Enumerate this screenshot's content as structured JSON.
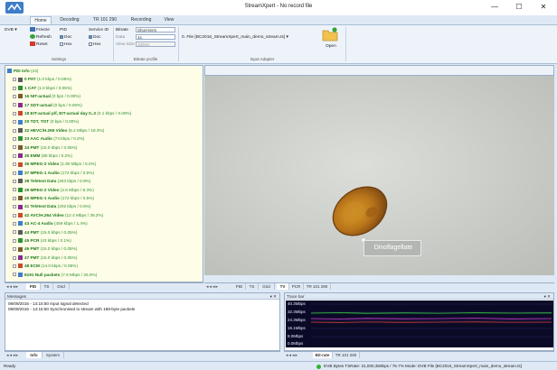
{
  "window": {
    "title": "StreamXpert - No record file",
    "minimize": "—",
    "maximize": "☐",
    "close": "✕"
  },
  "ribbon_tabs": [
    "Home",
    "Decoding",
    "TR 101 290",
    "Recording",
    "View"
  ],
  "ribbon": {
    "dvb": "DVB",
    "freeze": "Freeze",
    "refresh": "Refresh",
    "reset": "Reset",
    "pid": "PID",
    "doc_1": "Doc",
    "doc_2": "Doc",
    "hex_1": "Hex",
    "hex_2": "Hex",
    "service_id": "Service ID",
    "bitrate": "Bitrate",
    "data": "Data",
    "view_size": "View Size",
    "bitrate_value": "Short-term",
    "data_value": "1s",
    "view_size_value": "100ms",
    "group_settings": "Settings",
    "group_bitrate": "Bitrate profile",
    "group_input": "Input Adapter",
    "file_input": "0. File [BC2016_StreamXpert_main_demo_stream.ts]",
    "open": "Open"
  },
  "tree": [
    {
      "pid": "PID Info",
      "rate": "(24)"
    },
    {
      "pid": "0  PAT",
      "rate": "(1.0 kbps / 0.05%)"
    },
    {
      "pid": "1  CAT",
      "rate": "(1.0 kbps / 0.05%)"
    },
    {
      "pid": "16  NIT-actual",
      "rate": "(0 bps / 0.00%)"
    },
    {
      "pid": "17  SDT-actual",
      "rate": "(0 bps / 0.00%)"
    },
    {
      "pid": "18  EIT-actual p/f, EIT-actual day 0..3",
      "rate": "(0.1 kbps / 0.00%)"
    },
    {
      "pid": "20  TDT, TOT",
      "rate": "(0 bps / 0.00%)"
    },
    {
      "pid": "32  HEVC/H.265 Video",
      "rate": "(5.2 Mbps / 18.3%)"
    },
    {
      "pid": "33  AAC Audio",
      "rate": "(74 kbps / 0.2%)"
    },
    {
      "pid": "34  PMT",
      "rate": "(15.0 kbps / 0.05%)"
    },
    {
      "pid": "35  EMM",
      "rate": "(80 kbps / 0.2%)"
    },
    {
      "pid": "36  MPEG-2 Video",
      "rate": "(1.90 Mbps / 6.0%)"
    },
    {
      "pid": "37  MPEG-1 Audio",
      "rate": "(172 kbps / 0.5%)"
    },
    {
      "pid": "38  Teletext Data",
      "rate": "(263 kbps / 0.8%)"
    },
    {
      "pid": "39  MPEG-2 Video",
      "rate": "(2.6 Mbps / 8.3%)"
    },
    {
      "pid": "40  MPEG-1 Audio",
      "rate": "(172 kbps / 0.5%)"
    },
    {
      "pid": "41  Teletext Data",
      "rate": "(202 kbps / 0.6%)"
    },
    {
      "pid": "42  AVC/H.264 Video",
      "rate": "(12.4 Mbps / 39.2%)"
    },
    {
      "pid": "43  AC-4 Audio",
      "rate": "(459 kbps / 1.4%)"
    },
    {
      "pid": "44  PMT",
      "rate": "(15.0 kbps / 0.05%)"
    },
    {
      "pid": "45  PCR",
      "rate": "(43 kbps / 0.1%)"
    },
    {
      "pid": "46  PMT",
      "rate": "(15.0 kbps / 0.05%)"
    },
    {
      "pid": "47  PMT",
      "rate": "(15.0 kbps / 0.05%)"
    },
    {
      "pid": "48  ECM",
      "rate": "(14.0 kbps / 0.05%)"
    },
    {
      "pid": "8191  Null packets",
      "rate": "(7.9 Mbps / 25.0%)"
    }
  ],
  "tree_tabs": [
    "PID",
    "TS",
    "Grid"
  ],
  "video_tabs": [
    "PID",
    "TS",
    "Grid",
    "TV",
    "PCR",
    "TR 101 290"
  ],
  "video_caption": "Dinoflagellate",
  "messages": {
    "title": "Messages",
    "lines": [
      "09/09/2016 - 14:15:50 Input signal detected",
      "09/09/2016 - 14:15:50 Synchronised to stream with 188-byte packets"
    ],
    "tabs": [
      "Info",
      "System"
    ]
  },
  "tracebar": {
    "title": "Trace bar",
    "y_labels": [
      "40.3Mbps",
      "32.3Mbps",
      "24.3Mbps",
      "16.1Mbps",
      "8.0Mbps",
      "0.0Mbps"
    ],
    "tabs": [
      "Bit-rate",
      "TR 101 290"
    ]
  },
  "panel_controls": "▾ ✕",
  "status": {
    "left": "Ready",
    "right": "DVB Bytes  TSRate: 31,000,359bps / 75.7%  Mode: DVB  File  [BC2016_StreamXpert_main_demo_stream.ts]"
  },
  "colors": {
    "accent": "#4f8fd6",
    "tree_text": "#1a7a1a",
    "trace_bg": "#0a0a26"
  }
}
